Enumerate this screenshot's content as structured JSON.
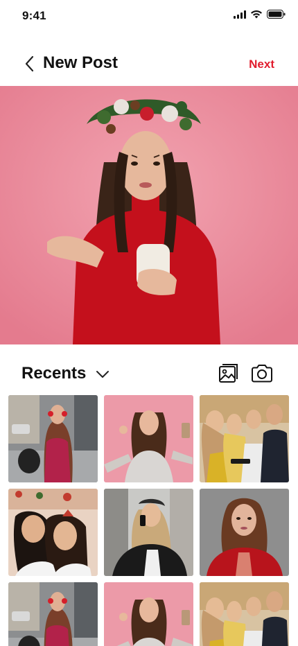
{
  "status_bar": {
    "time": "9:41",
    "icons": [
      "signal-icon",
      "wifi-icon",
      "battery-icon"
    ]
  },
  "header": {
    "title": "New Post",
    "next_label": "Next",
    "back_icon": "chevron-left-icon"
  },
  "preview": {
    "description_icon": "photo-preview"
  },
  "recents": {
    "label": "Recents",
    "dropdown_icon": "chevron-down-icon",
    "gallery_icon": "gallery-icon",
    "camera_icon": "camera-icon"
  },
  "colors": {
    "accent": "#e11d2e",
    "text": "#111111",
    "preview_bg": "#e98a9b"
  },
  "grid": {
    "items": [
      {
        "kind": "street-girl"
      },
      {
        "kind": "pink-girl"
      },
      {
        "kind": "friends-group"
      },
      {
        "kind": "two-girls"
      },
      {
        "kind": "phone-woman"
      },
      {
        "kind": "red-jacket-woman"
      },
      {
        "kind": "street-girl"
      },
      {
        "kind": "pink-girl"
      },
      {
        "kind": "friends-group"
      }
    ]
  }
}
